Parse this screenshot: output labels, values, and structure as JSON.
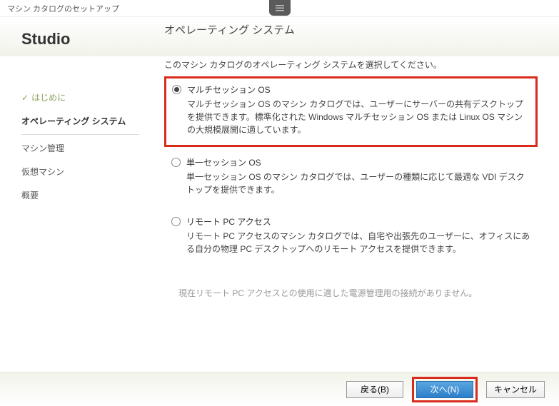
{
  "window": {
    "title": "マシン カタログのセットアップ"
  },
  "brand": "Studio",
  "nav": {
    "items": [
      {
        "label": "はじめに",
        "completed": true,
        "active": false
      },
      {
        "label": "オペレーティング システム",
        "completed": false,
        "active": true
      },
      {
        "label": "マシン管理",
        "completed": false,
        "active": false
      },
      {
        "label": "仮想マシン",
        "completed": false,
        "active": false
      },
      {
        "label": "概要",
        "completed": false,
        "active": false
      }
    ]
  },
  "main": {
    "heading": "オペレーティング システム",
    "instruction": "このマシン カタログのオペレーティング システムを選択してください。",
    "options": [
      {
        "label": "マルチセッション OS",
        "desc": "マルチセッション OS のマシン カタログでは、ユーザーにサーバーの共有デスクトップを提供できます。標準化された Windows マルチセッション OS または Linux OS マシンの大規模展開に適しています。",
        "selected": true,
        "highlighted": true
      },
      {
        "label": "単一セッション OS",
        "desc": "単一セッション OS のマシン カタログでは、ユーザーの種類に応じて最適な VDI デスクトップを提供できます。",
        "selected": false,
        "highlighted": false
      },
      {
        "label": "リモート PC アクセス",
        "desc": "リモート PC アクセスのマシン カタログでは、自宅や出張先のユーザーに、オフィスにある自分の物理 PC デスクトップへのリモート アクセスを提供できます。",
        "selected": false,
        "highlighted": false
      }
    ],
    "note": "現在リモート PC アクセスとの使用に適した電源管理用の接続がありません。"
  },
  "footer": {
    "back": "戻る(B)",
    "next": "次へ(N)",
    "cancel": "キャンセル"
  }
}
